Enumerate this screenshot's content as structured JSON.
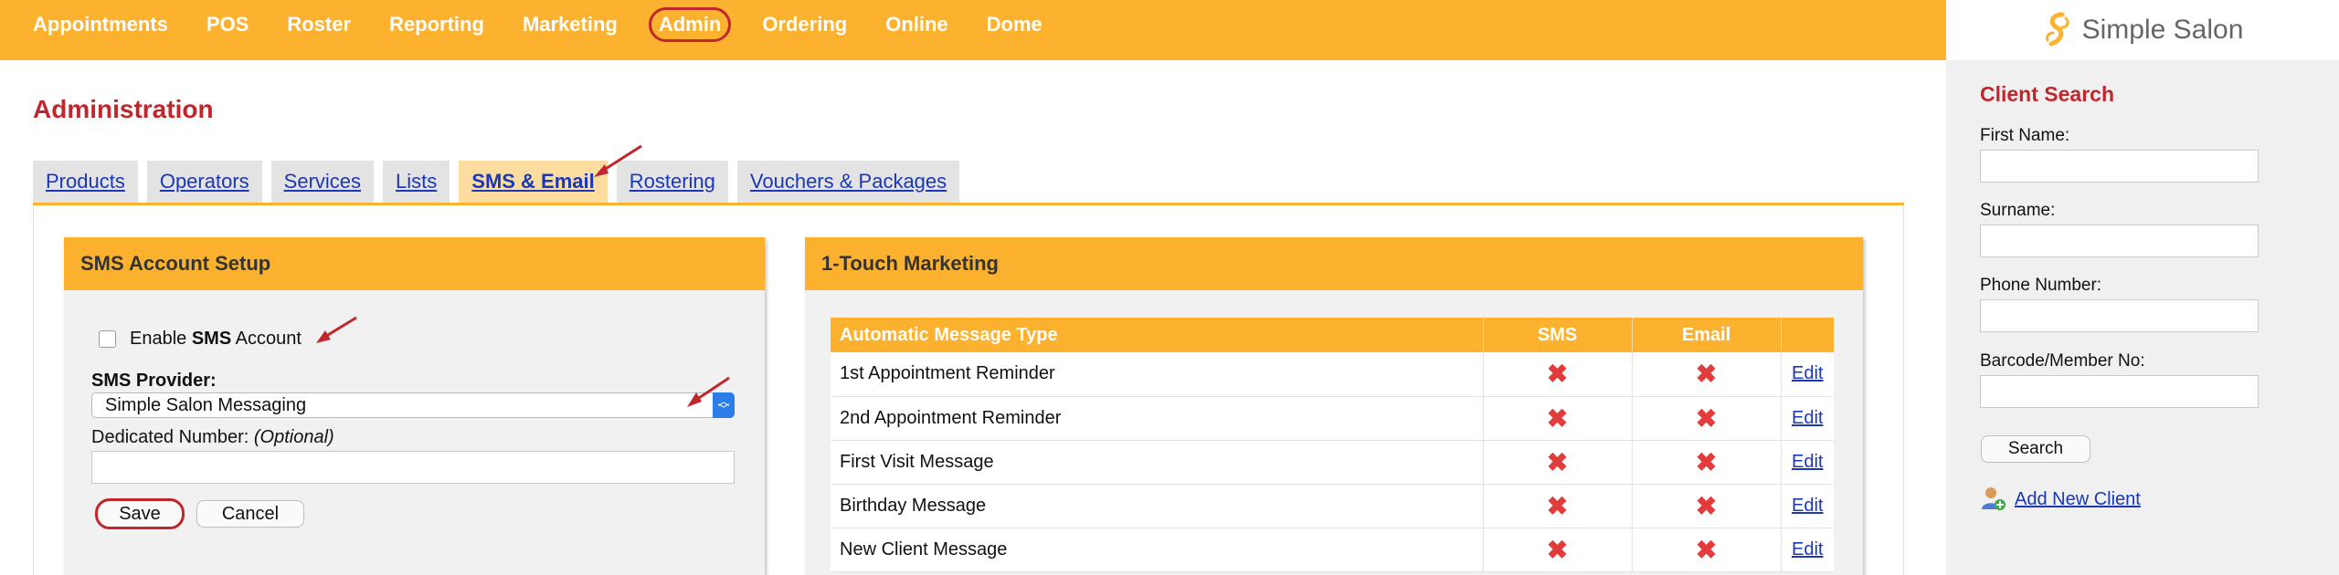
{
  "nav": {
    "items": [
      "Appointments",
      "POS",
      "Roster",
      "Reporting",
      "Marketing",
      "Admin",
      "Ordering",
      "Online",
      "Dome"
    ],
    "active": "Admin"
  },
  "brand": {
    "name": "Simple Salon",
    "icon": "simple-salon-logo-icon",
    "color": "#fdb22f"
  },
  "page": {
    "title": "Administration"
  },
  "tabs": {
    "items": [
      "Products",
      "Operators",
      "Services",
      "Lists",
      "SMS & Email",
      "Rostering",
      "Vouchers & Packages"
    ],
    "active": "SMS & Email"
  },
  "sms_setup": {
    "title": "SMS Account Setup",
    "enable_prefix": "Enable ",
    "enable_bold": "SMS",
    "enable_suffix": " Account",
    "enable_checked": false,
    "provider_label": "SMS Provider:",
    "provider_value": "Simple Salon Messaging",
    "dedicated_label": "Dedicated Number: ",
    "dedicated_optional": "(Optional)",
    "dedicated_value": "",
    "save_label": "Save",
    "cancel_label": "Cancel"
  },
  "marketing": {
    "title": "1-Touch Marketing",
    "columns": [
      "Automatic Message Type",
      "SMS",
      "Email",
      ""
    ],
    "rows": [
      {
        "type": "1st Appointment Reminder",
        "sms": "✖",
        "email": "✖",
        "action": "Edit"
      },
      {
        "type": "2nd Appointment Reminder",
        "sms": "✖",
        "email": "✖",
        "action": "Edit"
      },
      {
        "type": "First Visit Message",
        "sms": "✖",
        "email": "✖",
        "action": "Edit"
      },
      {
        "type": "Birthday Message",
        "sms": "✖",
        "email": "✖",
        "action": "Edit"
      },
      {
        "type": "New Client Message",
        "sms": "✖",
        "email": "✖",
        "action": "Edit"
      }
    ]
  },
  "client_search": {
    "title": "Client Search",
    "first_name_label": "First Name:",
    "surname_label": "Surname:",
    "phone_label": "Phone Number:",
    "barcode_label": "Barcode/Member No:",
    "search_label": "Search",
    "add_client_label": "Add New Client"
  },
  "colors": {
    "accent": "#fdb22f",
    "title_red": "#c0272d",
    "link_blue": "#1a37b8",
    "x_red": "#e23b3b"
  }
}
